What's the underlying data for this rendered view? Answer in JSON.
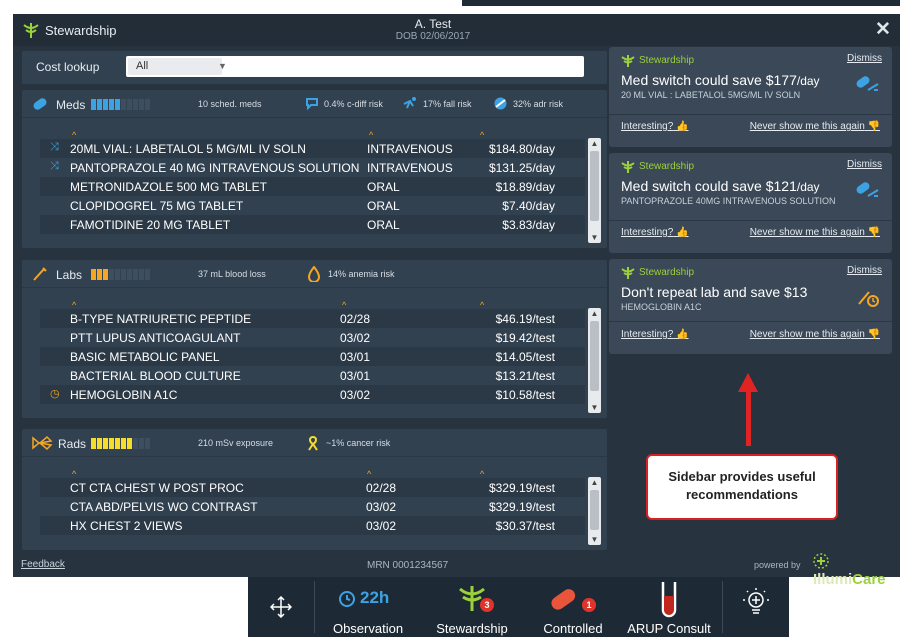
{
  "header": {
    "app_title": "Stewardship",
    "patient_name": "A. Test",
    "dob": "DOB 02/06/2017",
    "close": "✕"
  },
  "cost_lookup": {
    "label": "Cost lookup",
    "select_value": "All"
  },
  "meds": {
    "title": "Meds",
    "bars_on": 5,
    "bars_total": 10,
    "scheduled": "10 sched. meds",
    "risks": [
      "0.4% c-diff risk",
      "17% fall risk",
      "32% adr risk"
    ],
    "rows": [
      {
        "icon": "⤨",
        "name": "20ML VIAL: LABETALOL 5 MG/ML IV SOLN",
        "route": "INTRAVENOUS",
        "cost": "$184.80/day"
      },
      {
        "icon": "⤨",
        "name": "PANTOPRAZOLE 40 MG INTRAVENOUS SOLUTION",
        "route": "INTRAVENOUS",
        "cost": "$131.25/day"
      },
      {
        "icon": "",
        "name": "METRONIDAZOLE 500 MG TABLET",
        "route": "ORAL",
        "cost": "$18.89/day"
      },
      {
        "icon": "",
        "name": "CLOPIDOGREL 75 MG TABLET",
        "route": "ORAL",
        "cost": "$7.40/day"
      },
      {
        "icon": "",
        "name": "FAMOTIDINE 20 MG TABLET",
        "route": "ORAL",
        "cost": "$3.83/day"
      }
    ]
  },
  "labs": {
    "title": "Labs",
    "bars_on": 3,
    "bars_total": 10,
    "blood_loss": "37 mL blood loss",
    "risk": "14% anemia risk",
    "rows": [
      {
        "icon": "",
        "name": "B-TYPE NATRIURETIC PEPTIDE",
        "date": "02/28",
        "cost": "$46.19/test"
      },
      {
        "icon": "",
        "name": "PTT LUPUS ANTICOAGULANT",
        "date": "03/02",
        "cost": "$19.42/test"
      },
      {
        "icon": "",
        "name": "BASIC METABOLIC PANEL",
        "date": "03/01",
        "cost": "$14.05/test"
      },
      {
        "icon": "",
        "name": "BACTERIAL BLOOD CULTURE",
        "date": "03/01",
        "cost": "$13.21/test"
      },
      {
        "icon": "◷",
        "name": "HEMOGLOBIN A1C",
        "date": "03/02",
        "cost": "$10.58/test"
      }
    ]
  },
  "rads": {
    "title": "Rads",
    "bars_on": 7,
    "bars_total": 10,
    "exposure": "210 mSv exposure",
    "risk": "~1% cancer risk",
    "rows": [
      {
        "name": "CT CTA CHEST W POST PROC",
        "date": "02/28",
        "cost": "$329.19/test"
      },
      {
        "name": "CTA ABD/PELVIS WO CONTRAST",
        "date": "03/02",
        "cost": "$329.19/test"
      },
      {
        "name": "HX CHEST 2 VIEWS",
        "date": "03/02",
        "cost": "$30.37/test"
      }
    ]
  },
  "footer": {
    "feedback": "Feedback",
    "mrn": "MRN 0001234567",
    "powered_by": "powered by",
    "brand_a": "Illumi",
    "brand_b": "Care"
  },
  "sidebar": {
    "cards": [
      {
        "tag": "Stewardship",
        "dismiss": "Dismiss",
        "headline": "Med switch could save $177",
        "unit": "/day",
        "sub": "20 ML VIAL : LABETALOL 5MG/ML IV SOLN",
        "interesting": "Interesting?",
        "never": "Never show me this again"
      },
      {
        "tag": "Stewardship",
        "dismiss": "Dismiss",
        "headline": "Med switch could save $121",
        "unit": "/day",
        "sub": "PANTOPRAZOLE 40MG INTRAVENOUS SOLUTION",
        "interesting": "Interesting?",
        "never": "Never show me this again"
      },
      {
        "tag": "Stewardship",
        "dismiss": "Dismiss",
        "headline": "Don't repeat lab and save $13",
        "unit": "",
        "sub": "HEMOGLOBIN A1C",
        "interesting": "Interesting?",
        "never": "Never show me this again"
      }
    ]
  },
  "callout": {
    "line1": "Sidebar provides useful",
    "line2": "recommendations"
  },
  "toolbar": {
    "time": "22h",
    "observation": "Observation",
    "stewardship": "Stewardship",
    "stewardship_badge": "3",
    "controlled": "Controlled",
    "controlled_badge": "1",
    "arup": "ARUP Consult"
  },
  "colors": {
    "accent_blue": "#3da2e3",
    "accent_orange": "#f5a623",
    "accent_green": "#9bd13a",
    "alert_red": "#e02424"
  }
}
